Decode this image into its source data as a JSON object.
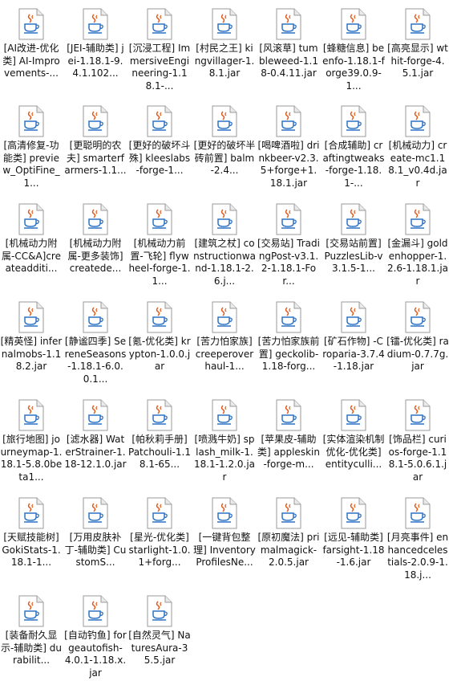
{
  "files": [
    {
      "name": "[AI改进-优化类] AI-Improvements-...",
      "icon": "java-jar-file-icon"
    },
    {
      "name": "[JEI-辅助类] jei-1.18.1-9.4.1.102...",
      "icon": "java-jar-file-icon"
    },
    {
      "name": "[沉浸工程] ImmersiveEngineering-1.18.1-...",
      "icon": "java-jar-file-icon"
    },
    {
      "name": "[村民之王] kingvillager-1.8.1.jar",
      "icon": "java-jar-file-icon"
    },
    {
      "name": "[风滚草] tumbleweed-1.18-0.4.11.jar",
      "icon": "java-jar-file-icon"
    },
    {
      "name": "[蜂糖信息] beenfo-1.18.1-forge39.0.9-1...",
      "icon": "java-jar-file-icon"
    },
    {
      "name": "[高亮显示] wthit-forge-4.5.1.jar",
      "icon": "java-jar-file-icon"
    },
    {
      "name": "[高清修复-功能类] preview_OptiFine_1...",
      "icon": "java-jar-file-icon"
    },
    {
      "name": "[更聪明的农夫] smarterfarmers-1.1...",
      "icon": "java-jar-file-icon"
    },
    {
      "name": "[更好的破坏斗殊] kleeslabs-forge-1...",
      "icon": "java-jar-file-icon"
    },
    {
      "name": "[更好的破坏半砖前置] balm-2.4...",
      "icon": "java-jar-file-icon"
    },
    {
      "name": "[喝啤酒啦] drinkbeer-v2.3.5+forge+1.18.1.jar",
      "icon": "java-jar-file-icon"
    },
    {
      "name": "[合成辅助] craftingtweaks-forge-1.18.1-...",
      "icon": "java-jar-file-icon"
    },
    {
      "name": "[机械动力] create-mc1.18.1_v0.4d.jar",
      "icon": "java-jar-file-icon"
    },
    {
      "name": "[机械动力附属-CC&A]createadditi...",
      "icon": "java-jar-file-icon"
    },
    {
      "name": "[机械动力附属-更多装饰] createde...",
      "icon": "java-jar-file-icon"
    },
    {
      "name": "[机械动力前置-飞轮] flywheel-forge-1.1...",
      "icon": "java-jar-file-icon"
    },
    {
      "name": "[建筑之杖] constructionwand-1.18.1-2.6.j...",
      "icon": "java-jar-file-icon"
    },
    {
      "name": "[交易站] TradingPost-v3.1.2-1.18.1-For...",
      "icon": "java-jar-file-icon"
    },
    {
      "name": "[交易站前置] PuzzlesLib-v3.1.5-1...",
      "icon": "java-jar-file-icon"
    },
    {
      "name": "[金漏斗] goldenhopper-1.2.6-1.18.1.jar",
      "icon": "java-jar-file-icon"
    },
    {
      "name": "[精英怪] infernalmobs-1.18.2.jar",
      "icon": "java-jar-file-icon"
    },
    {
      "name": "[静谧四季] SereneSeasons-1.18.1-6.0.0.1...",
      "icon": "java-jar-file-icon"
    },
    {
      "name": "[氪-优化类] krypton-1.0.0.jar",
      "icon": "java-jar-file-icon"
    },
    {
      "name": "[苦力怕家族] creeperoverhaul-1...",
      "icon": "java-jar-file-icon"
    },
    {
      "name": "[苦力怕家族前置] geckolib-1.18-forg...",
      "icon": "java-jar-file-icon"
    },
    {
      "name": "[矿石作物] -Croparia-3.7.4-1.18.jar",
      "icon": "java-jar-file-icon"
    },
    {
      "name": "[镭-优化类] radium-0.7.7g.jar",
      "icon": "java-jar-file-icon"
    },
    {
      "name": "[旅行地图] journeymap-1.18.1-5.8.0beta1...",
      "icon": "java-jar-file-icon"
    },
    {
      "name": "[滤水器] WaterStrainer-1.18-12.1.0.jar",
      "icon": "java-jar-file-icon"
    },
    {
      "name": "[帕秋莉手册] Patchouli-1.18.1-65...",
      "icon": "java-jar-file-icon"
    },
    {
      "name": "[喷溅牛奶] splash_milk-1.18.1-1.2.0.jar",
      "icon": "java-jar-file-icon"
    },
    {
      "name": "[苹果皮-辅助类] appleskin-forge-m...",
      "icon": "java-jar-file-icon"
    },
    {
      "name": "[实体渲染机制优化-优化类] entityculli...",
      "icon": "java-jar-file-icon"
    },
    {
      "name": "[饰品栏] curios-forge-1.18.1-5.0.6.1.jar",
      "icon": "java-jar-file-icon"
    },
    {
      "name": "[天赋技能树] GokiStats-1.18.1-1...",
      "icon": "java-jar-file-icon"
    },
    {
      "name": "[万用皮肤补丁-辅助类] CustomS...",
      "icon": "java-jar-file-icon"
    },
    {
      "name": "[星光-优化类] starlight-1.0.1+forg...",
      "icon": "java-jar-file-icon"
    },
    {
      "name": "[一键背包整理] InventoryProfilesNe...",
      "icon": "java-jar-file-icon"
    },
    {
      "name": "[原初魔法] primalmagick-2.0.5.jar",
      "icon": "java-jar-file-icon"
    },
    {
      "name": "[远见-辅助类] farsight-1.18-1.6.jar",
      "icon": "java-jar-file-icon"
    },
    {
      "name": "[月亮事件] enhancedcelestials-2.0.9-1.18.j...",
      "icon": "java-jar-file-icon"
    },
    {
      "name": "[装备耐久显示-辅助类] durabilit...",
      "icon": "java-jar-file-icon"
    },
    {
      "name": "[自动钓鱼] forgeautofish-4.0.1-1.18.x.jar",
      "icon": "java-jar-file-icon"
    },
    {
      "name": "[自然灵气] NaturesAura-35.5.jar",
      "icon": "java-jar-file-icon"
    }
  ],
  "colors": {
    "label_text": "#111111",
    "cup": "#2f73c4",
    "steam": "#e05a1a"
  }
}
